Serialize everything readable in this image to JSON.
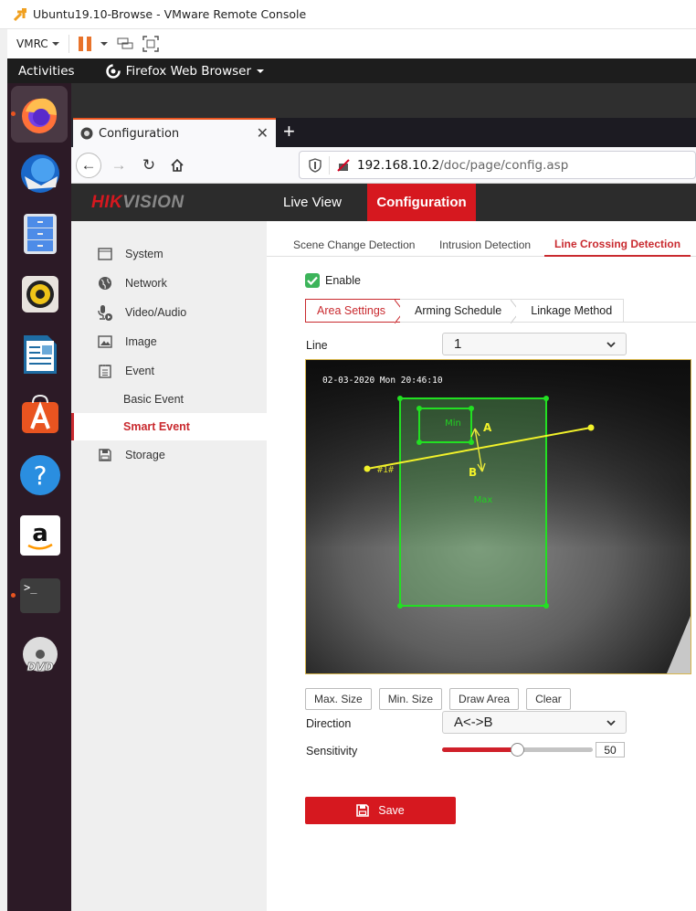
{
  "vmrc": {
    "window_title": "Ubuntu19.10-Browse - VMware Remote Console",
    "menu_label": "VMRC"
  },
  "gnome": {
    "activities": "Activities",
    "app_menu": "Firefox Web Browser"
  },
  "dock": {
    "items": [
      {
        "name": "firefox",
        "running": true,
        "active": true
      },
      {
        "name": "thunderbird",
        "running": false
      },
      {
        "name": "files",
        "running": false
      },
      {
        "name": "rhythmbox",
        "running": false
      },
      {
        "name": "libreoffice-writer",
        "running": false
      },
      {
        "name": "ubuntu-software",
        "running": false
      },
      {
        "name": "help",
        "running": false
      },
      {
        "name": "amazon",
        "running": false
      },
      {
        "name": "terminal",
        "running": true
      },
      {
        "name": "dvd",
        "running": false
      }
    ]
  },
  "browser": {
    "tab_title": "Configuration",
    "new_tab": "+",
    "url_host": "192.168.10.2",
    "url_path": "/doc/page/config.asp"
  },
  "hik": {
    "logo_hik": "HIK",
    "logo_vision": "VISION",
    "nav": [
      "Live View",
      "Configuration"
    ],
    "sidebar": {
      "items": [
        "System",
        "Network",
        "Video/Audio",
        "Image",
        "Event"
      ],
      "sub_items": [
        "Basic Event",
        "Smart Event"
      ],
      "storage": "Storage"
    },
    "detection_tabs": [
      "Scene Change Detection",
      "Intrusion Detection",
      "Line Crossing Detection"
    ],
    "enable_label": "Enable",
    "enable_checked": true,
    "sub_tabs": [
      "Area Settings",
      "Arming Schedule",
      "Linkage Method"
    ],
    "line_label": "Line",
    "line_value": "1",
    "video": {
      "osd_timestamp": "02-03-2020 Mon 20:46:10",
      "min_label": "Min",
      "max_label": "Max",
      "line_id_label": "#1#",
      "side_a": "A",
      "side_b": "B"
    },
    "buttons": [
      "Max. Size",
      "Min. Size",
      "Draw Area",
      "Clear"
    ],
    "direction_label": "Direction",
    "direction_value": "A<->B",
    "sensitivity_label": "Sensitivity",
    "sensitivity_value": "50",
    "sensitivity_percent": 50,
    "save_label": "Save",
    "colors": {
      "brand_red": "#d6181f",
      "zone_green": "#22e022",
      "line_yellow": "#f2f22a"
    }
  }
}
